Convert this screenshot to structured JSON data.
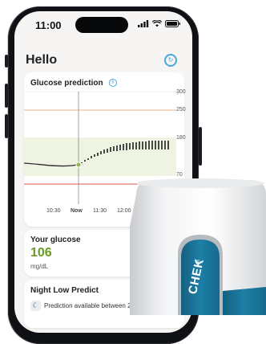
{
  "status_bar": {
    "time": "11:00"
  },
  "header": {
    "title": "Hello",
    "sync_icon": "refresh-icon"
  },
  "prediction_card": {
    "title": "Glucose prediction",
    "info_icon": "info-icon",
    "y_ticks": [
      "300",
      "250",
      "180",
      "70"
    ],
    "x_ticks": [
      "10:30",
      "Now",
      "11:30",
      "12:00",
      "12"
    ]
  },
  "glucose_card": {
    "label": "Your glucose",
    "value": "106",
    "unit": "mg/dL"
  },
  "night_card": {
    "title": "Night Low Predict",
    "message": "Prediction available between 2"
  },
  "device": {
    "brand_fragment": "CHEK",
    "registered": "®"
  },
  "colors": {
    "accent": "#4aa6d6",
    "target_band": "#eef4e1",
    "high_line": "#e7b489",
    "low_line": "#d9534f",
    "glucose_value": "#6a9a1f",
    "device_blue": "#1e7fa6"
  }
}
